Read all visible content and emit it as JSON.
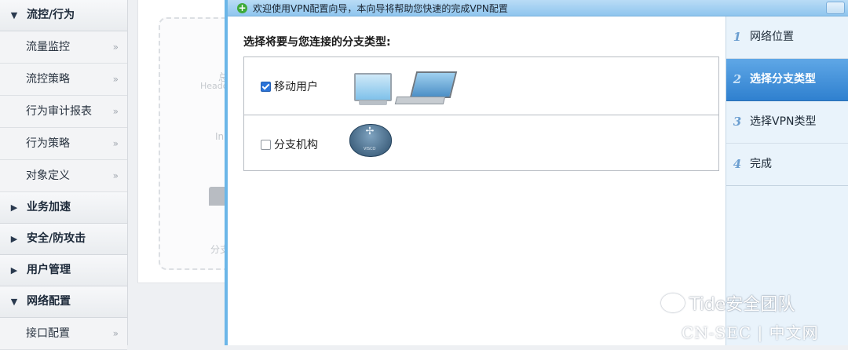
{
  "sidebar": {
    "groups": [
      {
        "label": "流控/行为",
        "expanded": true,
        "items": [
          "流量监控",
          "流控策略",
          "行为审计报表",
          "行为策略",
          "对象定义"
        ]
      },
      {
        "label": "业务加速",
        "expanded": false
      },
      {
        "label": "安全/防攻击",
        "expanded": false
      },
      {
        "label": "用户管理",
        "expanded": false
      },
      {
        "label": "网络配置",
        "expanded": true,
        "items": [
          "接口配置"
        ]
      }
    ],
    "chevron": "»"
  },
  "background": {
    "fragment1": "总",
    "fragment2": "Heado",
    "fragment3": "In",
    "fragment4": "分支"
  },
  "dialog": {
    "title": "欢迎使用VPN配置向导，本向导将帮助您快速的完成VPN配置",
    "prompt": "选择将要与您连接的分支类型:",
    "options": [
      {
        "label": "移动用户",
        "checked": true,
        "icons": [
          "desktop-monitor-icon",
          "laptop-icon"
        ]
      },
      {
        "label": "分支机构",
        "checked": false,
        "icons": [
          "router-icon"
        ]
      }
    ],
    "router_tag": "VISCO"
  },
  "steps": [
    {
      "num": "1",
      "label": "网络位置",
      "active": false
    },
    {
      "num": "2",
      "label": "选择分支类型",
      "active": true
    },
    {
      "num": "3",
      "label": "选择VPN类型",
      "active": false
    },
    {
      "num": "4",
      "label": "完成",
      "active": false
    }
  ],
  "watermark": {
    "line1": "Tide安全团队",
    "line2": "CN-SEC | 中文网"
  },
  "colors": {
    "accent": "#2f80cf",
    "title_bar": "#9fcdf0",
    "checkbox_on": "#2b74d8"
  }
}
